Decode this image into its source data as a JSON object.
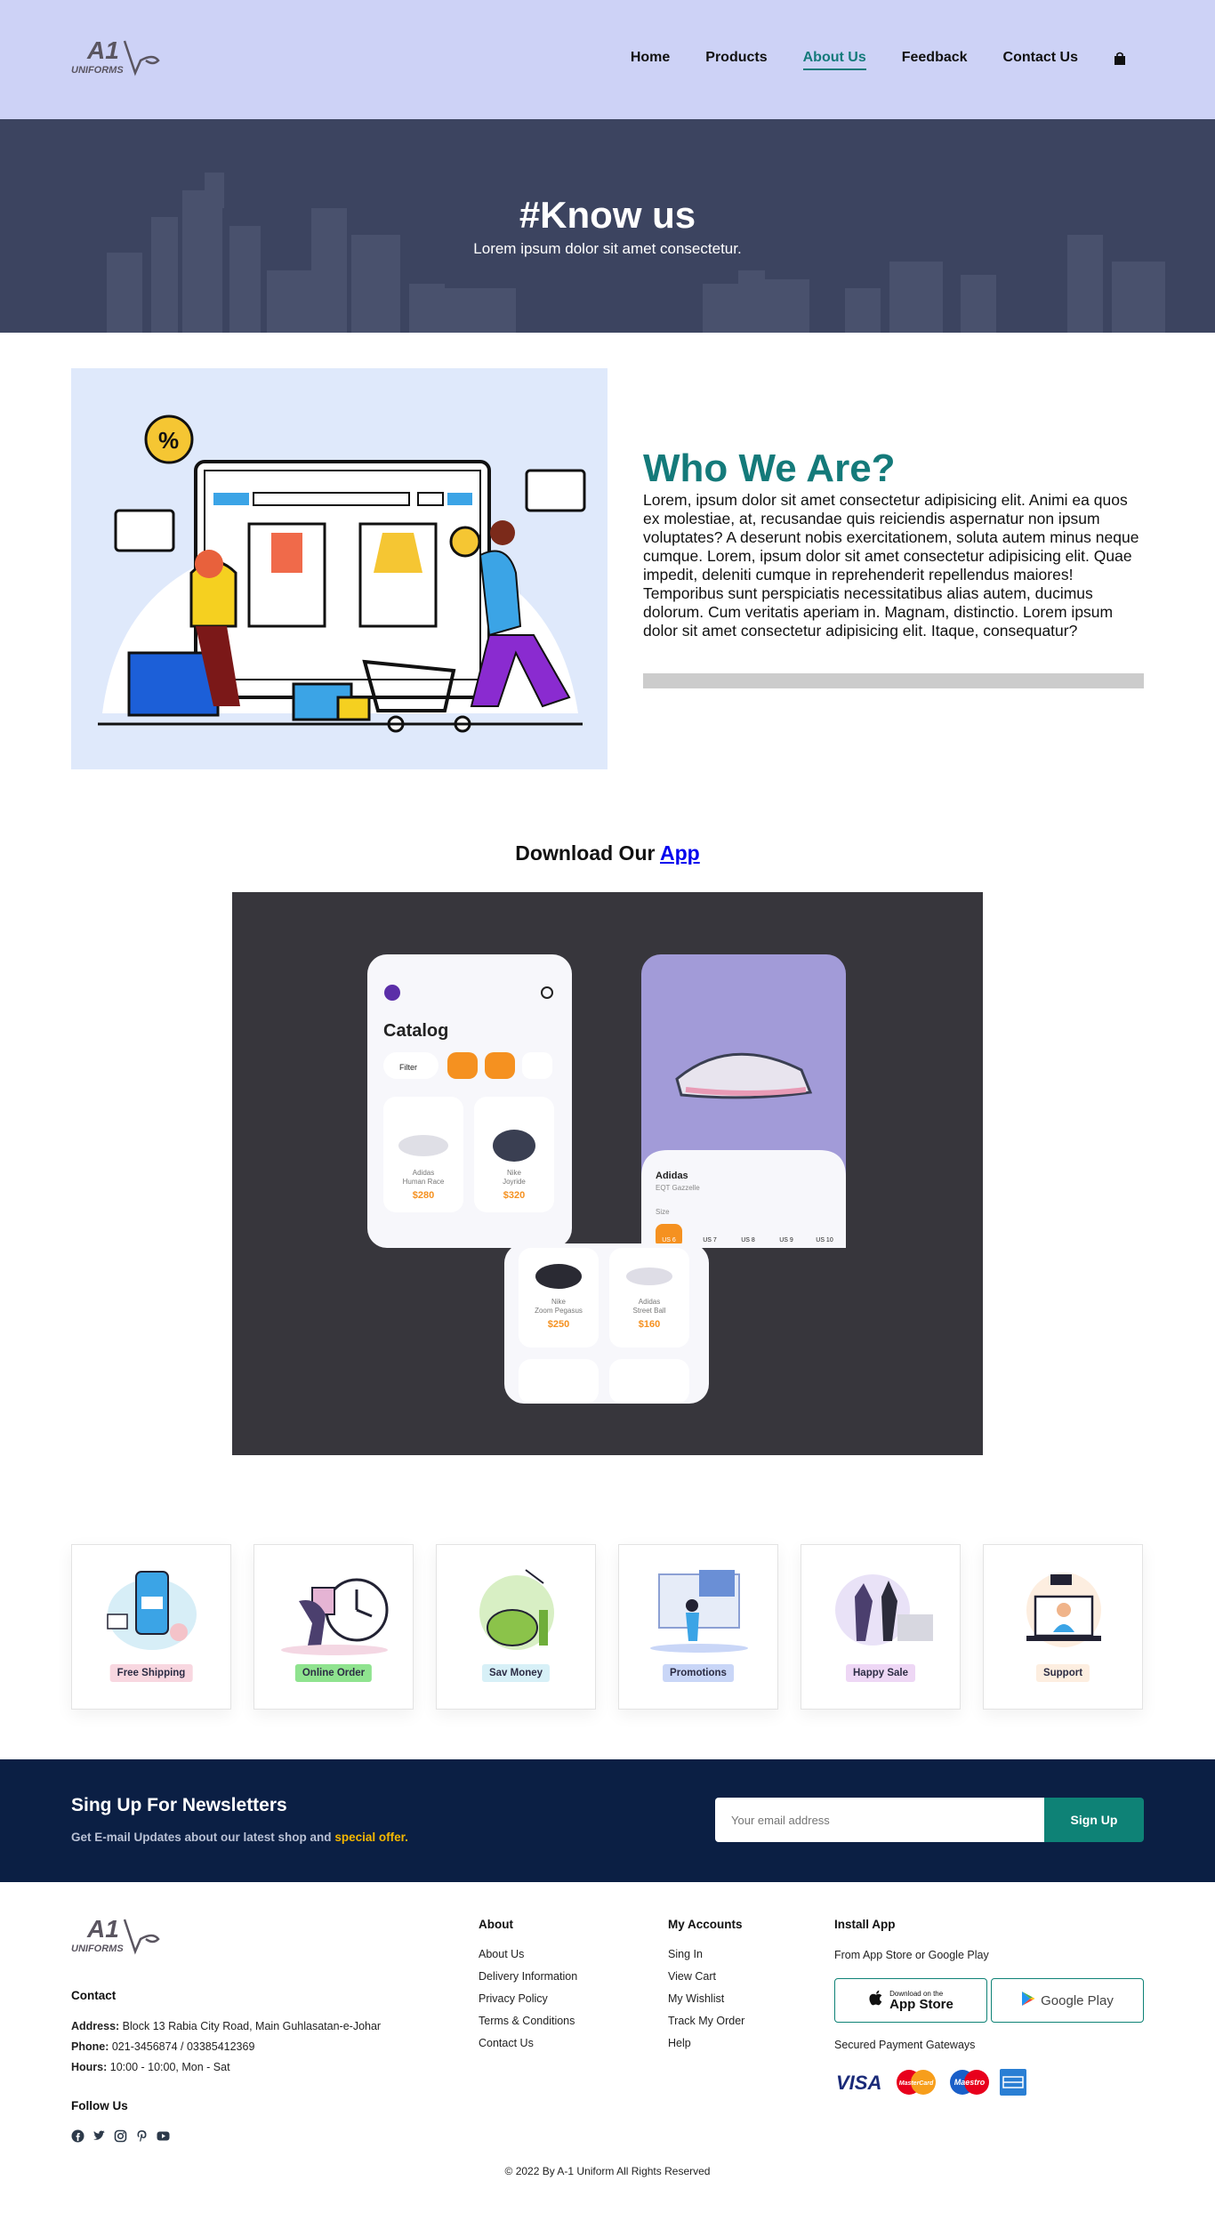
{
  "brand": {
    "logo_text": "A1",
    "logo_sub": "UNIFORMS"
  },
  "nav": {
    "items": [
      {
        "label": "Home"
      },
      {
        "label": "Products"
      },
      {
        "label": "About Us"
      },
      {
        "label": "Feedback"
      },
      {
        "label": "Contact Us"
      }
    ],
    "active": "About Us",
    "cart_icon": "shopping-bag-icon"
  },
  "hero": {
    "title": "#Know us",
    "subtitle": "Lorem ipsum dolor sit amet consectetur."
  },
  "who": {
    "title": "Who We Are?",
    "text": "Lorem, ipsum dolor sit amet consectetur adipisicing elit. Animi ea quos ex molestiae, at, recusandae quis reiciendis aspernatur non ipsum voluptates? A deserunt nobis exercitationem, soluta autem minus neque cumque. Lorem, ipsum dolor sit amet consectetur adipisicing elit. Quae impedit, deleniti cumque in reprehenderit repellendus maiores! Temporibus sunt perspiciatis necessitatibus alias autem, ducimus dolorum. Cum veritatis aperiam in. Magnam, distinctio. Lorem ipsum dolor sit amet consectetur adipisicing elit. Itaque, consequatur?"
  },
  "download": {
    "prefix": "Download Our",
    "link": "App",
    "mockup": {
      "catalog_title": "Catalog",
      "filter_label": "Filter",
      "products": [
        {
          "brand": "Adidas",
          "name": "Human Race",
          "price": "$280"
        },
        {
          "brand": "Nike",
          "name": "Joyride",
          "price": "$320"
        },
        {
          "brand": "Nike",
          "name": "Zoom Pegasus",
          "price": "$250"
        },
        {
          "brand": "Adidas",
          "name": "Street Ball",
          "price": "$160"
        }
      ],
      "detail_brand": "Adidas",
      "detail_name": "EQT Gazzelle",
      "size_label": "Size",
      "sizes": [
        "US 6",
        "US 7",
        "US 8",
        "US 9",
        "US 10"
      ]
    }
  },
  "features": [
    {
      "label": "Free Shipping",
      "bg": "#f8d7e0"
    },
    {
      "label": "Online Order",
      "bg": "#8fe38f"
    },
    {
      "label": "Sav Money",
      "bg": "#d7f0f7"
    },
    {
      "label": "Promotions",
      "bg": "#c9d6f7"
    },
    {
      "label": "Happy Sale",
      "bg": "#eed7f5"
    },
    {
      "label": "Support",
      "bg": "#fdeee0"
    }
  ],
  "newsletter": {
    "title": "Sing Up For Newsletters",
    "sub_prefix": "Get E-mail Updates about our latest shop and",
    "sub_highlight": "special offer.",
    "placeholder": "Your email address",
    "button": "Sign Up"
  },
  "footer": {
    "contact_heading": "Contact",
    "address_label": "Address:",
    "address": "Block 13 Rabia City Road, Main Guhlasatan-e-Johar",
    "phone_label": "Phone:",
    "phone": "021-3456874 / 03385412369",
    "hours_label": "Hours:",
    "hours": "10:00 - 10:00, Mon - Sat",
    "follow_heading": "Follow Us",
    "about_heading": "About",
    "about_links": [
      "About Us",
      "Delivery Information",
      "Privacy Policy",
      "Terms & Conditions",
      "Contact Us"
    ],
    "accounts_heading": "My Accounts",
    "accounts_links": [
      "Sing In",
      "View Cart",
      "My Wishlist",
      "Track My Order",
      "Help"
    ],
    "install_heading": "Install App",
    "install_sub": "From App Store or Google Play",
    "appstore_small": "Download on the",
    "appstore_big": "App Store",
    "googleplay": "Google Play",
    "payments_label": "Secured Payment Gateways",
    "visa": "VISA",
    "mastercard": "MasterCard",
    "maestro": "Maestro",
    "copyright": "© 2022 By A-1 Uniform All Rights Reserved"
  }
}
